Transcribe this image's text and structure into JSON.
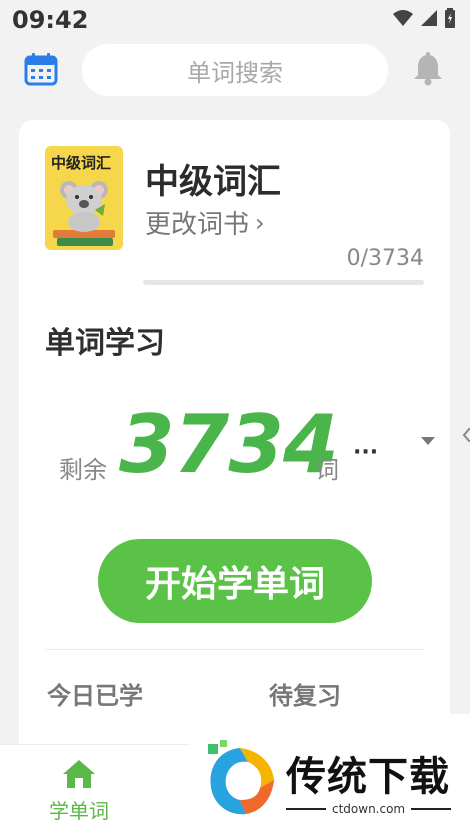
{
  "status_bar": {
    "time": "09:42",
    "icons": [
      "wifi-icon",
      "signal-icon",
      "battery-icon"
    ]
  },
  "top_bar": {
    "calendar_icon": "calendar-icon",
    "search_placeholder": "单词搜索",
    "bell_icon": "bell-icon"
  },
  "book": {
    "cover_label": "中级词汇",
    "name": "中级词汇",
    "change_label": "更改词书",
    "progress_text": "0/3734",
    "progress_fraction": 0
  },
  "study": {
    "section_title": "单词学习",
    "remaining_label": "剩余",
    "remaining_count": "3734",
    "unit": "词",
    "more": "···",
    "start_button": "开始学单词"
  },
  "stats": {
    "today_label": "今日已学",
    "review_label": "待复习"
  },
  "bottom_nav": {
    "items": [
      {
        "label": "学单词",
        "icon": "home-icon",
        "active": true
      }
    ]
  },
  "watermark": {
    "title": "传统下载",
    "subtitle": "ctdown.com"
  },
  "colors": {
    "accent_green": "#5ac247",
    "count_green": "#4ab54a",
    "calendar_blue": "#2b7de9",
    "background": "#f2f2f2"
  }
}
